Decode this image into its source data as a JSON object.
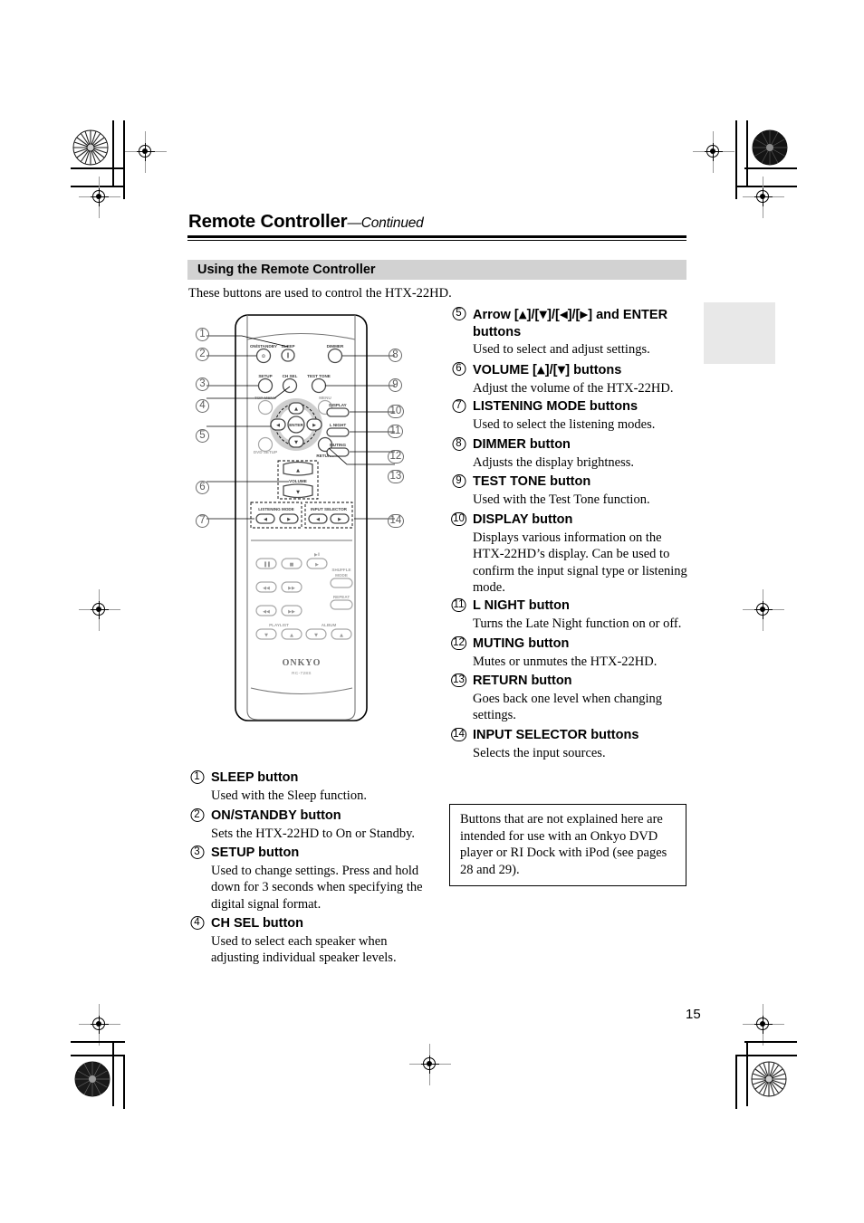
{
  "header": {
    "title": "Remote Controller",
    "continued": "—Continued"
  },
  "section": {
    "band_title": "Using the Remote Controller",
    "intro": "These buttons are used to control the HTX-22HD."
  },
  "page_number": "15",
  "note_box": {
    "text": "Buttons that are not explained here are intended for use with an Onkyo DVD player or RI Dock with iPod (see pages 28 and 29)."
  },
  "left_entries": [
    {
      "num": "1",
      "head": "SLEEP button",
      "desc": "Used with the Sleep function."
    },
    {
      "num": "2",
      "head": "ON/STANDBY button",
      "desc": "Sets the HTX-22HD to On or Standby."
    },
    {
      "num": "3",
      "head": "SETUP button",
      "desc": "Used to change settings. Press and hold down for 3 seconds when specifying the digital signal format."
    },
    {
      "num": "4",
      "head": "CH SEL button",
      "desc": "Used to select each speaker when adjusting individual speaker levels."
    }
  ],
  "right_entries": [
    {
      "num": "5",
      "head_prefix": "Arrow [",
      "head_suffix": "] and ENTER buttons",
      "head_full": "Arrow [▲]/[▼]/[◀]/[▶] and ENTER buttons",
      "desc": "Used to select and adjust settings."
    },
    {
      "num": "6",
      "head_full": "VOLUME [▲]/[▼] buttons",
      "desc": "Adjust the volume of the HTX-22HD."
    },
    {
      "num": "7",
      "head_full": "LISTENING MODE buttons",
      "desc": "Used to select the listening modes."
    },
    {
      "num": "8",
      "head_full": "DIMMER button",
      "desc": "Adjusts the display brightness."
    },
    {
      "num": "9",
      "head_full": "TEST TONE button",
      "desc": "Used with the Test Tone function."
    },
    {
      "num": "10",
      "head_full": "DISPLAY button",
      "desc": "Displays various information on the HTX-22HD’s display. Can be used to confirm the input signal type or listening mode."
    },
    {
      "num": "11",
      "head_full": "L NIGHT button",
      "desc": "Turns the Late Night function on or off."
    },
    {
      "num": "12",
      "head_full": "MUTING button",
      "desc": "Mutes or unmutes the HTX-22HD."
    },
    {
      "num": "13",
      "head_full": "RETURN button",
      "desc": "Goes back one level when changing settings."
    },
    {
      "num": "14",
      "head_full": "INPUT SELECTOR buttons",
      "desc": "Selects the input sources."
    }
  ],
  "remote": {
    "brand": "ONKYO",
    "model": "RC-728S",
    "labels": {
      "on_standby": "ON/STANDBY",
      "sleep": "SLEEP",
      "dimmer": "DIMMER",
      "setup": "SETUP",
      "ch_sel": "CH SEL",
      "test_tone": "TEST TONE",
      "top_menu": "TOP MENU",
      "menu": "MENU",
      "display": "DISPLAY",
      "l_night": "L NIGHT",
      "muting": "MUTING",
      "dvd_setup": "DVD SETUP",
      "return": "RETURN",
      "enter": "ENTER",
      "volume": "VOLUME",
      "listening_mode": "LISTENING MODE",
      "input_selector": "INPUT SELECTOR",
      "shuffle_mode": "SHUFFLE MODE",
      "repeat": "REPEAT",
      "playlist": "PLAYLIST",
      "album": "ALBUM",
      "play_pause": "▶‖"
    }
  },
  "callouts": {
    "left": [
      "1",
      "2",
      "3",
      "4",
      "5",
      "6",
      "7"
    ],
    "right": [
      "8",
      "9",
      "10",
      "11",
      "12",
      "13",
      "14"
    ]
  }
}
